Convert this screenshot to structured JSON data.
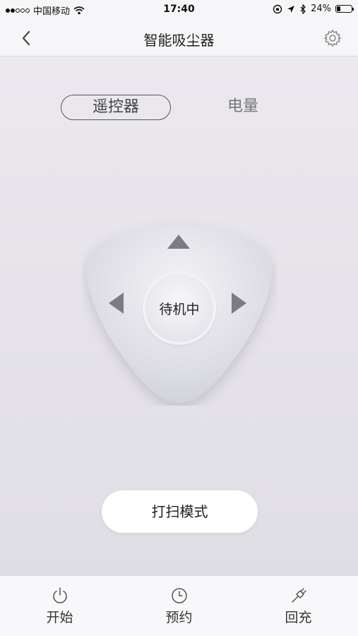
{
  "status_bar": {
    "carrier": "中国移动",
    "time": "17:40",
    "battery": "24%",
    "battery_level": 0.24,
    "signal_bars_filled": 2,
    "signal_bars_total": 5
  },
  "nav": {
    "title": "智能吸尘器",
    "back_icon": "chevron-left-icon",
    "settings_icon": "gear-icon"
  },
  "tabs": [
    {
      "label": "遥控器",
      "selected": true
    },
    {
      "label": "电量",
      "selected": false
    }
  ],
  "remote": {
    "status": "待机中",
    "up_icon": "arrow-up-icon",
    "left_icon": "arrow-left-icon",
    "right_icon": "arrow-right-icon"
  },
  "mode_button": {
    "label": "打扫模式"
  },
  "bottom_bar": {
    "items": [
      {
        "label": "开始",
        "icon": "power-icon"
      },
      {
        "label": "预约",
        "icon": "clock-icon"
      },
      {
        "label": "回充",
        "icon": "plug-icon"
      }
    ]
  },
  "colors": {
    "arrow": "#7b7b83",
    "background_top": "#ebe9ee",
    "background_bottom": "#e0dee5",
    "bar": "#f6f6f8"
  }
}
